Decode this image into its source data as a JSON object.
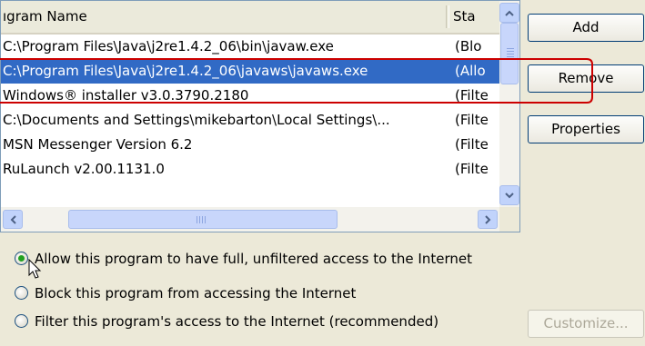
{
  "program_list": {
    "columns": {
      "name": "ıgram Name",
      "status": "Sta"
    },
    "rows": [
      {
        "name": "C:\\Program Files\\Java\\j2re1.4.2_06\\bin\\javaw.exe",
        "status": "(Blo"
      },
      {
        "name": "C:\\Program Files\\Java\\j2re1.4.2_06\\javaws\\javaws.exe",
        "status": "(Allo"
      },
      {
        "name": "Windows® installer v3.0.3790.2180",
        "status": "(Filte"
      },
      {
        "name": "C:\\Documents and Settings\\mikebarton\\Local Settings\\...",
        "status": "(Filte"
      },
      {
        "name": "MSN Messenger Version 6.2",
        "status": "(Filte"
      },
      {
        "name": "RuLaunch v2.00.1131.0",
        "status": "(Filte"
      }
    ],
    "selected_row": 1
  },
  "buttons": {
    "add": "Add",
    "remove": "Remove",
    "properties": "Properties",
    "customize": "Customize..."
  },
  "options": {
    "allow": "Allow this program to have full, unfiltered access to the Internet",
    "block": "Block this program from accessing the Internet",
    "filter": "Filter this program's access to the Internet (recommended)",
    "selected": "allow"
  },
  "colors": {
    "selection": "#316ac5",
    "annotation": "#cc0000",
    "radio_dot": "#21a121"
  },
  "icons": {
    "scroll_up": "up-arrow",
    "scroll_down": "down-arrow",
    "scroll_left": "left-arrow",
    "scroll_right": "right-arrow",
    "cursor": "mouse-pointer"
  }
}
